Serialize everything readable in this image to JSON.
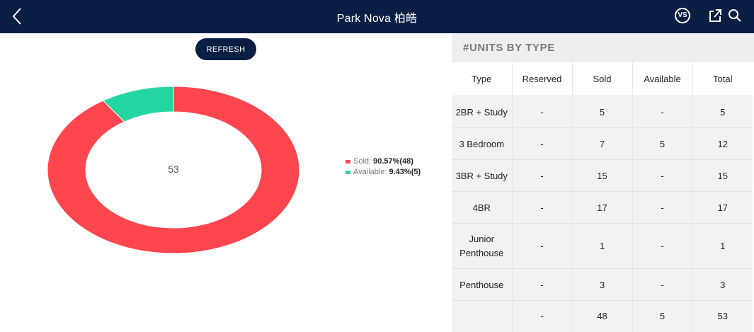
{
  "header": {
    "title": "Park Nova 柏皓",
    "vs_label": "VS"
  },
  "refresh_label": "REFRESH",
  "colors": {
    "navy": "#0b1e44",
    "sold": "#ff454e",
    "available": "#23d6a2"
  },
  "chart_data": {
    "type": "pie",
    "center_label": "53",
    "series": [
      {
        "name": "Sold",
        "value": 48,
        "percent": "90.57%",
        "display": "90.57%(48)",
        "color": "#ff454e"
      },
      {
        "name": "Available",
        "value": 5,
        "percent": "9.43%",
        "display": "9.43%(5)",
        "color": "#23d6a2"
      }
    ]
  },
  "units_panel": {
    "title": "#UNITS BY TYPE",
    "columns": [
      "Type",
      "Reserved",
      "Sold",
      "Available",
      "Total"
    ],
    "rows": [
      [
        "2BR + Study",
        "-",
        "5",
        "-",
        "5"
      ],
      [
        "3 Bedroom",
        "-",
        "7",
        "5",
        "12"
      ],
      [
        "3BR + Study",
        "-",
        "15",
        "-",
        "15"
      ],
      [
        "4BR",
        "-",
        "17",
        "-",
        "17"
      ],
      [
        "Junior Penthouse",
        "-",
        "1",
        "-",
        "1"
      ],
      [
        "Penthouse",
        "-",
        "3",
        "-",
        "3"
      ],
      [
        "",
        "-",
        "48",
        "5",
        "53"
      ]
    ]
  }
}
